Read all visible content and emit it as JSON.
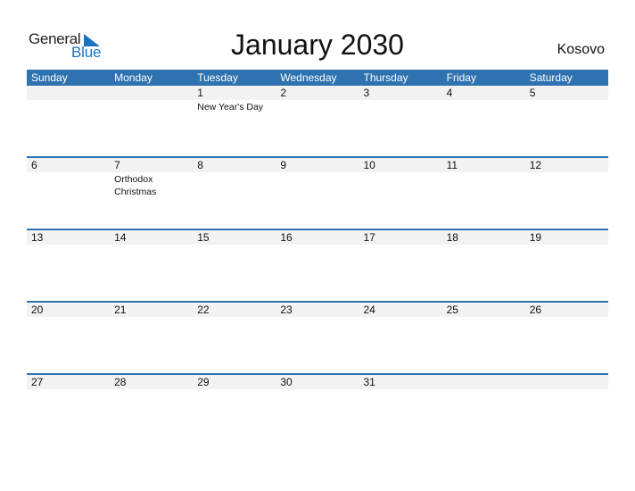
{
  "logo": {
    "general": "General",
    "blue": "Blue"
  },
  "title": "January 2030",
  "country": "Kosovo",
  "weekdays": [
    "Sunday",
    "Monday",
    "Tuesday",
    "Wednesday",
    "Thursday",
    "Friday",
    "Saturday"
  ],
  "colors": {
    "header": "#2e72b0",
    "logo_blue": "#1a72c0",
    "date_strip": "#f2f2f2"
  },
  "weeks": [
    [
      {
        "day": ""
      },
      {
        "day": ""
      },
      {
        "day": "1",
        "holiday": "New Year's Day"
      },
      {
        "day": "2"
      },
      {
        "day": "3"
      },
      {
        "day": "4"
      },
      {
        "day": "5"
      }
    ],
    [
      {
        "day": "6"
      },
      {
        "day": "7",
        "holiday": "Orthodox Christmas"
      },
      {
        "day": "8"
      },
      {
        "day": "9"
      },
      {
        "day": "10"
      },
      {
        "day": "11"
      },
      {
        "day": "12"
      }
    ],
    [
      {
        "day": "13"
      },
      {
        "day": "14"
      },
      {
        "day": "15"
      },
      {
        "day": "16"
      },
      {
        "day": "17"
      },
      {
        "day": "18"
      },
      {
        "day": "19"
      }
    ],
    [
      {
        "day": "20"
      },
      {
        "day": "21"
      },
      {
        "day": "22"
      },
      {
        "day": "23"
      },
      {
        "day": "24"
      },
      {
        "day": "25"
      },
      {
        "day": "26"
      }
    ],
    [
      {
        "day": "27"
      },
      {
        "day": "28"
      },
      {
        "day": "29"
      },
      {
        "day": "30"
      },
      {
        "day": "31"
      },
      {
        "day": ""
      },
      {
        "day": ""
      }
    ]
  ]
}
